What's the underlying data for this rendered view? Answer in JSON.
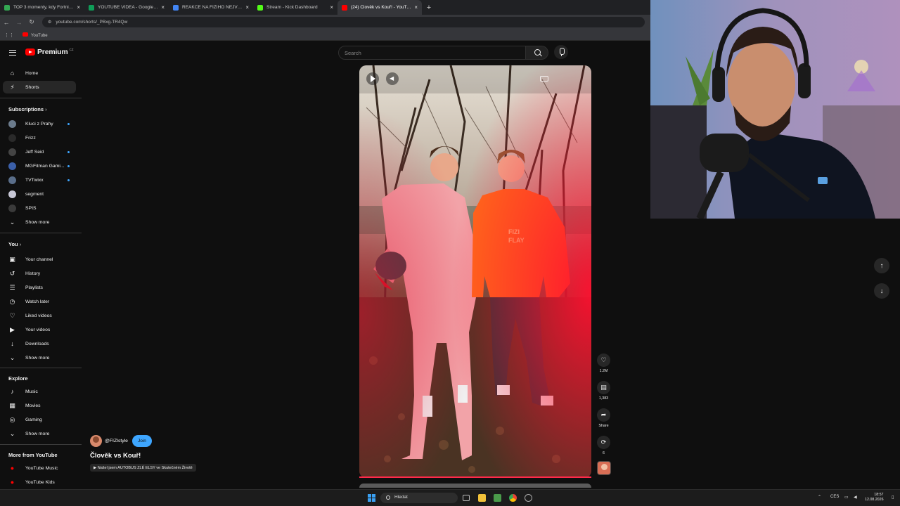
{
  "browser": {
    "tabs": [
      {
        "title": "TOP 3 momenty, kdy Fortnite S",
        "color": "#34a853",
        "active": false
      },
      {
        "title": "YOUTUBE VIDEA - Google Shee",
        "color": "#0f9d58",
        "active": false
      },
      {
        "title": "REAKCE NA FIZIHO NEJVIC OB",
        "color": "#4285f4",
        "active": false
      },
      {
        "title": "Stream - Kick Dashboard",
        "color": "#53fc18",
        "active": false
      },
      {
        "title": "(24) Člověk vs Kouř! - YouTube",
        "color": "#ff0000",
        "active": true
      }
    ],
    "new_tab": "+",
    "url": "youtube.com/shorts/_PBxg-TR4Qw",
    "bookmark": "YouTube"
  },
  "header": {
    "logo_text": "Premium",
    "logo_badge": "CZ",
    "search_placeholder": "Search"
  },
  "sidebar": {
    "top": [
      {
        "label": "Home",
        "icon": "home-icon",
        "glyph": "⌂",
        "active": false
      },
      {
        "label": "Shorts",
        "icon": "shorts-icon",
        "glyph": "⚡",
        "active": true
      }
    ],
    "subscriptions_title": "Subscriptions",
    "subscriptions": [
      {
        "label": "Kluci z Prahy",
        "color": "#6b7b8c",
        "dot": true
      },
      {
        "label": "Frizz",
        "color": "#2a2a2a",
        "dot": false
      },
      {
        "label": "Jeff Seid",
        "color": "#444444",
        "dot": true
      },
      {
        "label": "MGFitman Gami...",
        "color": "#3b5fa8",
        "dot": true
      },
      {
        "label": "TVTwixx",
        "color": "#5a6e8a",
        "dot": true
      },
      {
        "label": "segment",
        "color": "#c7c7d6",
        "dot": false
      },
      {
        "label": "SPIS",
        "color": "#3a3a3a",
        "dot": false
      }
    ],
    "show_more_1": "Show more",
    "you_title": "You",
    "you": [
      {
        "label": "Your channel",
        "icon": "your-channel-icon",
        "glyph": "▣"
      },
      {
        "label": "History",
        "icon": "history-icon",
        "glyph": "↺"
      },
      {
        "label": "Playlists",
        "icon": "playlists-icon",
        "glyph": "☰"
      },
      {
        "label": "Watch later",
        "icon": "watch-later-icon",
        "glyph": "◷"
      },
      {
        "label": "Liked videos",
        "icon": "liked-videos-icon",
        "glyph": "♡"
      },
      {
        "label": "Your videos",
        "icon": "your-videos-icon",
        "glyph": "▶"
      },
      {
        "label": "Downloads",
        "icon": "downloads-icon",
        "glyph": "↓"
      }
    ],
    "show_more_2": "Show more",
    "explore_title": "Explore",
    "explore": [
      {
        "label": "Music",
        "icon": "music-icon",
        "glyph": "♪"
      },
      {
        "label": "Movies",
        "icon": "movies-icon",
        "glyph": "▦"
      },
      {
        "label": "Gaming",
        "icon": "gaming-icon",
        "glyph": "◎"
      }
    ],
    "show_more_3": "Show more",
    "more_title": "More from YouTube",
    "more": [
      {
        "label": "YouTube Music",
        "color": "#ff0000"
      },
      {
        "label": "YouTube Kids",
        "color": "#ff0000"
      }
    ]
  },
  "short": {
    "channel_handle": "@FIZIstyle",
    "join_label": "Join",
    "title": "Člověk vs Kouř!",
    "related_pill": "▶ Našel jsem AUTOBUS ZLÉ ELSY ve Skutečném Životě",
    "actions": [
      {
        "name": "like",
        "glyph": "♡",
        "label": "1.2M"
      },
      {
        "name": "comments",
        "glyph": "▤",
        "label": "1,383"
      },
      {
        "name": "share",
        "glyph": "➦",
        "label": "Share"
      },
      {
        "name": "remix",
        "glyph": "⟳",
        "label": "6"
      }
    ]
  },
  "taskbar": {
    "search": "Hledat",
    "lang": "CES",
    "time": "18:57",
    "date": "12.08.2026"
  }
}
